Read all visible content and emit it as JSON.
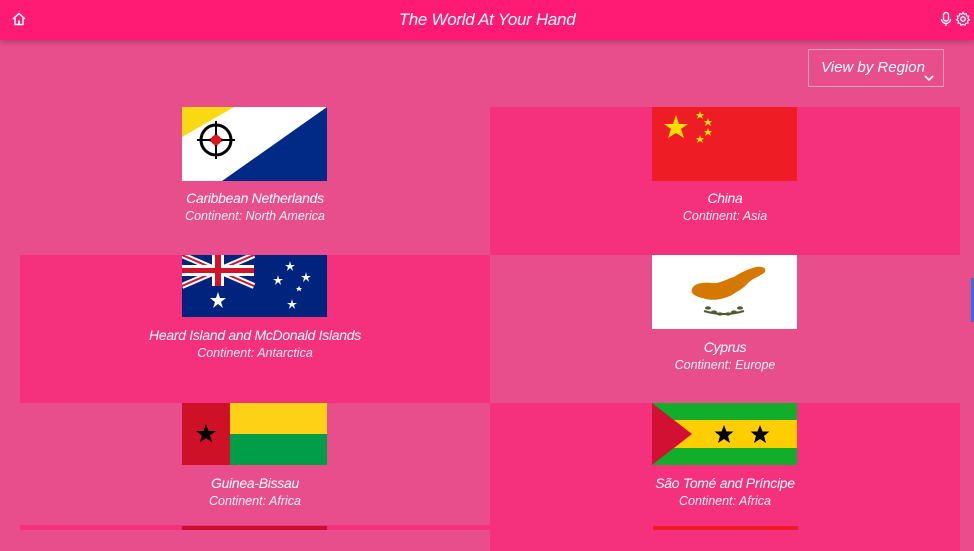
{
  "header": {
    "title": "The World At Your Hand",
    "icons": {
      "home": "home-icon",
      "mic": "microphone-icon",
      "settings": "gear-icon"
    }
  },
  "filter": {
    "label": "View by Region",
    "icon": "chevron-down-icon"
  },
  "colors": {
    "header_bg": "#ff1a73",
    "page_bg": "#e94e8c",
    "card_alt_bg": "#f5317e"
  },
  "countries": [
    {
      "name": "Caribbean Netherlands",
      "continent": "Continent: North America",
      "flag": "bonaire-flag"
    },
    {
      "name": "China",
      "continent": "Continent: Asia",
      "flag": "china-flag"
    },
    {
      "name": "Heard Island and McDonald Islands",
      "continent": "Continent: Antarctica",
      "flag": "australia-flag"
    },
    {
      "name": "Cyprus",
      "continent": "Continent: Europe",
      "flag": "cyprus-flag"
    },
    {
      "name": "Guinea-Bissau",
      "continent": "Continent: Africa",
      "flag": "guinea-bissau-flag"
    },
    {
      "name": "São Tomé and Príncipe",
      "continent": "Continent: Africa",
      "flag": "sao-tome-flag"
    }
  ]
}
